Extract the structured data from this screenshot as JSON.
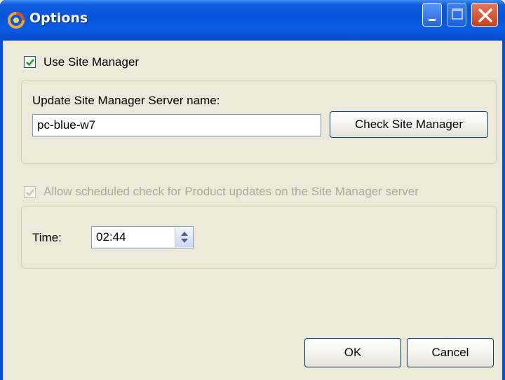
{
  "window": {
    "title": "Options",
    "icon": "app-logo-icon"
  },
  "site_manager": {
    "use_label": "Use Site Manager",
    "use_checked": true,
    "group_label": "Update Site Manager Server name:",
    "server_value": "pc-blue-w7",
    "check_button": "Check Site Manager"
  },
  "schedule": {
    "allow_label": "Allow scheduled check for Product updates on the Site Manager server",
    "allow_checked": true,
    "allow_enabled": false,
    "time_label": "Time:",
    "time_value": "02:44"
  },
  "footer": {
    "ok_label": "OK",
    "cancel_label": "Cancel"
  },
  "colors": {
    "titlebar": "#0855dd",
    "dialog_bg": "#ece9d8",
    "checkmark": "#21a121"
  }
}
